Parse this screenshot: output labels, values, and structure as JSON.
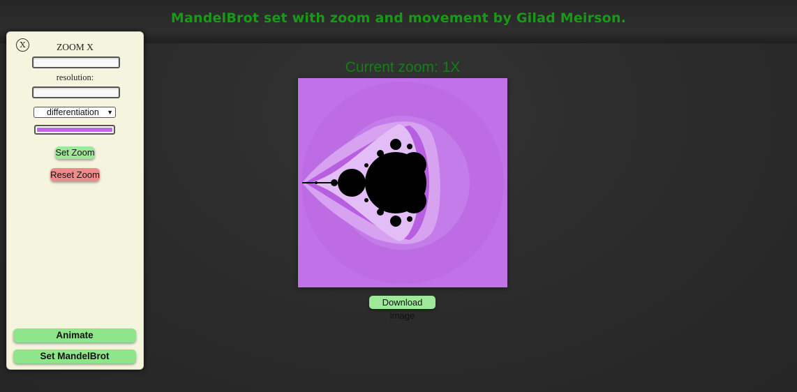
{
  "header": {
    "title": "MandelBrot set with zoom and movement by Gilad Meirson."
  },
  "sidebar": {
    "close_label": "X",
    "zoom_label": "ZOOM X",
    "zoom_value": "",
    "resolution_label": "resolution:",
    "resolution_value": "",
    "color_mode_selected": "differentiation",
    "color_value": "#c066e6",
    "set_zoom_label": "Set Zoom",
    "reset_zoom_label": "Reset Zoom",
    "animate_label": "Animate",
    "set_mandelbrot_label": "Set MandelBrot"
  },
  "main": {
    "zoom_caption": "Current zoom: 1X",
    "download_label": "Download image"
  },
  "colors": {
    "title": "#179b17",
    "sidebar_bg": "#f5f5df",
    "accent_green": "#9ee89a",
    "accent_red": "#f08b8b",
    "fractal_base": "#c272e8",
    "fractal_set": "#000000"
  }
}
